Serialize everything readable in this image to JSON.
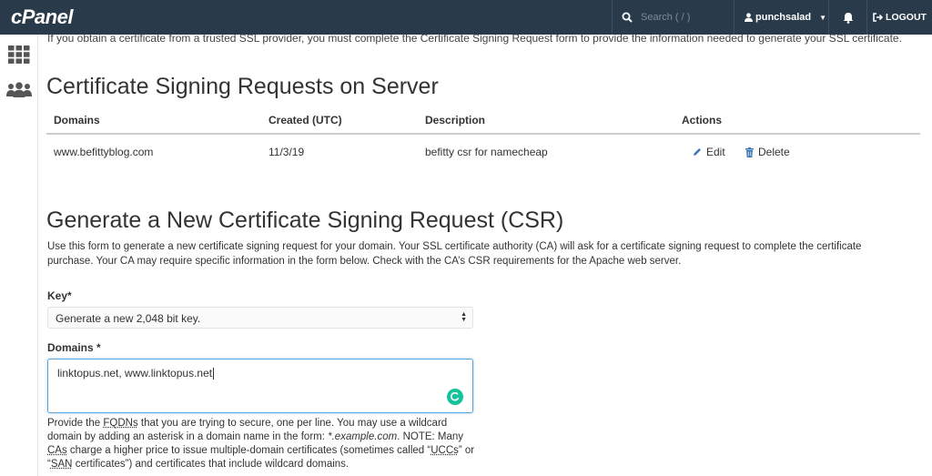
{
  "topbar": {
    "logo": "cPanel",
    "search_placeholder": "Search ( / )",
    "username": "punchsalad",
    "logout_label": "LOGOUT"
  },
  "colors": {
    "topbar_bg": "#293a4a",
    "link": "#3a76b5",
    "grammarly": "#15c39a"
  },
  "page": {
    "cut_off_text": "If you obtain a certificate from a trusted SSL provider, you must complete the Certificate Signing Request form to provide the information needed to generate your SSL certificate.",
    "csr_section_title": "Certificate Signing Requests on Server",
    "table": {
      "headers": [
        "Domains",
        "Created (UTC)",
        "Description",
        "Actions"
      ],
      "rows": [
        {
          "domain": "www.befittyblog.com",
          "created": "11/3/19",
          "description": "befitty csr for namecheap",
          "edit_label": "Edit",
          "delete_label": "Delete"
        }
      ]
    },
    "generate_title": "Generate a New Certificate Signing Request (CSR)",
    "intro_text": "Use this form to generate a new certificate signing request for your domain. Your SSL certificate authority (CA) will ask for a certificate signing request to complete the certificate purchase. Your CA may require specific information in the form below. Check with the CA’s CSR requirements for the Apache web server.",
    "form": {
      "key_label": "Key*",
      "key_value": "Generate a new 2,048 bit key.",
      "domains_label": "Domains *",
      "domains_value": "linktopus.net, www.linktopus.net",
      "help": {
        "p1": "Provide the ",
        "fqdns": "FQDNs",
        "p2": " that you are trying to secure, one per line. You may use a wildcard domain by adding an asterisk in a domain name in the form: ",
        "example": "*.example.com",
        "p3": ". NOTE: Many ",
        "cas": "CAs",
        "p4": " charge a higher price to issue multiple-domain certificates (sometimes called “",
        "uccs": "UCCs",
        "p5": "” or “",
        "san": "SAN",
        "p6": " certificates”) and certificates that include wildcard domains."
      }
    }
  },
  "icons": [
    "search-icon",
    "user-icon",
    "chevron-down-icon",
    "bell-icon",
    "logout-icon",
    "grid-icon",
    "users-icon",
    "pencil-icon",
    "trash-icon",
    "grammarly-icon"
  ]
}
